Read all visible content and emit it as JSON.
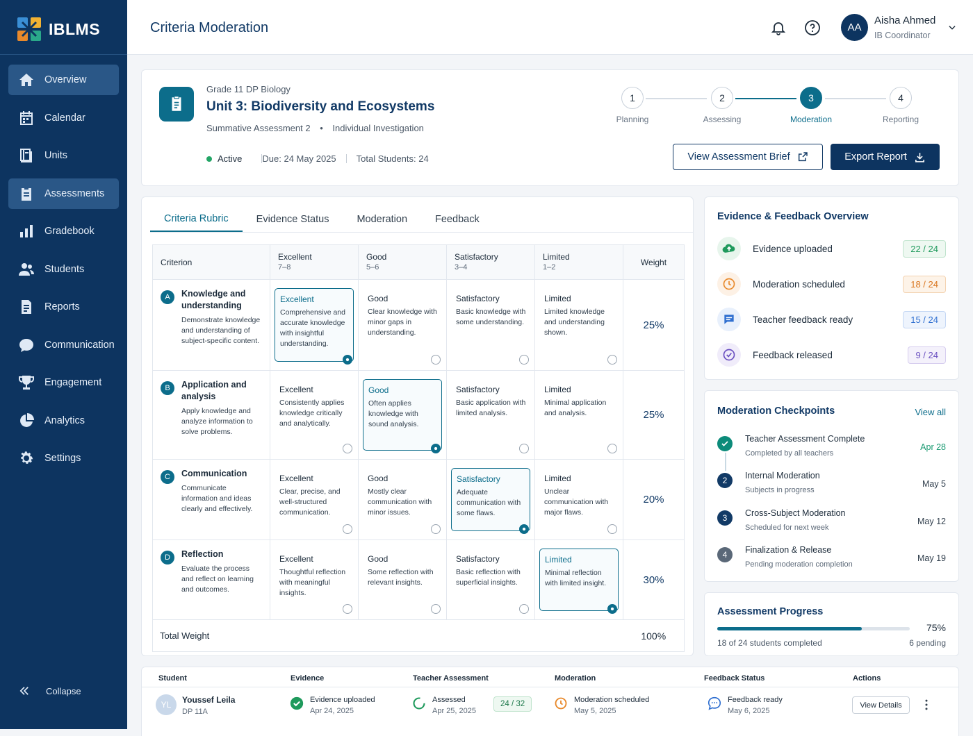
{
  "app": {
    "name": "IBLMS"
  },
  "sidebar": {
    "items": [
      {
        "label": "Overview",
        "icon": "home-icon"
      },
      {
        "label": "Calendar",
        "icon": "calendar-icon"
      },
      {
        "label": "Units",
        "icon": "book-icon"
      },
      {
        "label": "Assessments",
        "icon": "clipboard-icon"
      },
      {
        "label": "Gradebook",
        "icon": "bar-chart-icon"
      },
      {
        "label": "Students",
        "icon": "users-icon"
      },
      {
        "label": "Reports",
        "icon": "report-icon"
      },
      {
        "label": "Communication",
        "icon": "chat-icon"
      },
      {
        "label": "Engagement",
        "icon": "trophy-icon"
      },
      {
        "label": "Analytics",
        "icon": "pie-chart-icon"
      },
      {
        "label": "Settings",
        "icon": "gear-icon"
      }
    ],
    "collapse_label": "Collapse"
  },
  "header": {
    "title": "Criteria Moderation",
    "user": {
      "initials": "AA",
      "name": "Aisha Ahmed",
      "role": "IB Coordinator"
    }
  },
  "assessment": {
    "grade": "Grade 11 DP Biology",
    "title": "Unit 3: Biodiversity and Ecosystems",
    "type": "Summative Assessment 2",
    "mode": "Individual Investigation",
    "status": "Active",
    "due": "Due: 24 May 2025",
    "total_students": "Total Students: 24",
    "steps": [
      {
        "num": "1",
        "label": "Planning",
        "active": false
      },
      {
        "num": "2",
        "label": "Assessing",
        "active": false
      },
      {
        "num": "3",
        "label": "Moderation",
        "active": true
      },
      {
        "num": "4",
        "label": "Reporting",
        "active": false
      }
    ],
    "buttons": {
      "brief": "View Assessment Brief",
      "export": "Export Report"
    }
  },
  "tabs": [
    "Criteria Rubric",
    "Evidence Status",
    "Moderation",
    "Feedback"
  ],
  "rubric": {
    "headers": [
      {
        "name": "Criterion",
        "range": ""
      },
      {
        "name": "Excellent",
        "range": "7–8"
      },
      {
        "name": "Good",
        "range": "5–6"
      },
      {
        "name": "Satisfactory",
        "range": "3–4"
      },
      {
        "name": "Limited",
        "range": "1–2"
      },
      {
        "name": "Weight",
        "range": ""
      }
    ],
    "rows": [
      {
        "letter": "A",
        "name": "Knowledge and understanding",
        "desc": "Demonstrate knowledge and understanding of subject-specific content.",
        "weight": "25%",
        "selected": 0,
        "cells": [
          {
            "level": "Excellent",
            "text": "Comprehensive and accurate knowledge with insightful understanding."
          },
          {
            "level": "Good",
            "text": "Clear knowledge with minor gaps in understanding."
          },
          {
            "level": "Satisfactory",
            "text": "Basic knowledge with some understanding."
          },
          {
            "level": "Limited",
            "text": "Limited knowledge and understanding shown."
          }
        ]
      },
      {
        "letter": "B",
        "name": "Application and analysis",
        "desc": "Apply knowledge and analyze information to solve problems.",
        "weight": "25%",
        "selected": 1,
        "cells": [
          {
            "level": "Excellent",
            "text": "Consistently applies knowledge critically and analytically."
          },
          {
            "level": "Good",
            "text": "Often applies knowledge with sound analysis."
          },
          {
            "level": "Satisfactory",
            "text": "Basic application with limited analysis."
          },
          {
            "level": "Limited",
            "text": "Minimal application and analysis."
          }
        ]
      },
      {
        "letter": "C",
        "name": "Communication",
        "desc": "Communicate information and ideas clearly and effectively.",
        "weight": "20%",
        "selected": 2,
        "cells": [
          {
            "level": "Excellent",
            "text": "Clear, precise, and well-structured communication."
          },
          {
            "level": "Good",
            "text": "Mostly clear communication with minor issues."
          },
          {
            "level": "Satisfactory",
            "text": "Adequate communication with some flaws."
          },
          {
            "level": "Limited",
            "text": "Unclear communication with major flaws."
          }
        ]
      },
      {
        "letter": "D",
        "name": "Reflection",
        "desc": "Evaluate the process and reflect on learning and outcomes.",
        "weight": "30%",
        "selected": 3,
        "cells": [
          {
            "level": "Excellent",
            "text": "Thoughtful reflection with meaningful insights."
          },
          {
            "level": "Good",
            "text": "Some reflection with relevant insights."
          },
          {
            "level": "Satisfactory",
            "text": "Basic reflection with superficial insights."
          },
          {
            "level": "Limited",
            "text": "Minimal reflection with limited insight."
          }
        ]
      }
    ],
    "total_label": "Total Weight",
    "total_value": "100%"
  },
  "overview": {
    "title": "Evidence & Feedback Overview",
    "items": [
      {
        "label": "Evidence uploaded",
        "count": "22 / 24",
        "icon": "upload-cloud-icon",
        "color": "#1f9a5c"
      },
      {
        "label": "Moderation scheduled",
        "count": "18 / 24",
        "icon": "clock-icon",
        "color": "#e8892b"
      },
      {
        "label": "Teacher feedback ready",
        "count": "15 / 24",
        "icon": "message-icon",
        "color": "#2f6fd0"
      },
      {
        "label": "Feedback released",
        "count": "9 / 24",
        "icon": "check-circle-icon",
        "color": "#6a4fc0"
      }
    ]
  },
  "checkpoints": {
    "title": "Moderation Checkpoints",
    "view_all": "View all",
    "items": [
      {
        "num": "",
        "title": "Teacher Assessment Complete",
        "sub": "Completed by all teachers",
        "date": "Apr 28",
        "done": true
      },
      {
        "num": "2",
        "title": "Internal Moderation",
        "sub": "Subjects in progress",
        "date": "May 5",
        "done": false
      },
      {
        "num": "3",
        "title": "Cross-Subject Moderation",
        "sub": "Scheduled for next week",
        "date": "May 12",
        "done": false
      },
      {
        "num": "4",
        "title": "Finalization & Release",
        "sub": "Pending moderation completion",
        "date": "May 19",
        "done": false
      }
    ]
  },
  "progress": {
    "title": "Assessment Progress",
    "percent": "75%",
    "fraction": 0.75,
    "completed": "18 of 24 students completed",
    "pending": "6 pending"
  },
  "students_table": {
    "headers": [
      "Student",
      "Evidence",
      "Teacher Assessment",
      "Moderation",
      "Feedback Status",
      "Actions"
    ],
    "rows": [
      {
        "initials": "YL",
        "name": "Youssef Leila",
        "class": "DP 11A",
        "evidence": "Evidence uploaded",
        "evidence_date": "Apr 24, 2025",
        "assessed": "Assessed",
        "assessed_date": "Apr 25, 2025",
        "score": "24 / 32",
        "moderation": "Moderation scheduled",
        "moderation_date": "May 5, 2025",
        "feedback": "Feedback ready",
        "feedback_date": "May 6, 2025",
        "action": "View Details"
      }
    ]
  }
}
